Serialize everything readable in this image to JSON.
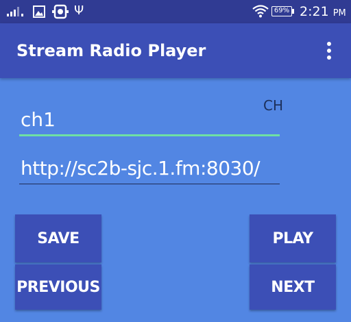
{
  "status_bar": {
    "battery": "69%",
    "time": "2:21",
    "ampm": "PM",
    "usb_glyph": "Ψ",
    "icons": [
      "signal-icon",
      "image-icon",
      "notification-icon",
      "usb-icon",
      "wifi-icon",
      "battery-icon"
    ]
  },
  "app_bar": {
    "title": "Stream Radio Player",
    "menu_icon": "more-vert-icon"
  },
  "form": {
    "channel_label": "CH",
    "name_value": "ch1",
    "url_value": "http://sc2b-sjc.1.fm:8030/"
  },
  "buttons": {
    "save": "SAVE",
    "previous": "PREVIOUS",
    "play": "PLAY",
    "next": "NEXT"
  },
  "colors": {
    "background": "#5286e3",
    "status_bar": "#303b93",
    "app_bar": "#3c4fb6",
    "button": "#3c4fb6",
    "focus_underline": "#6fe0a3"
  }
}
